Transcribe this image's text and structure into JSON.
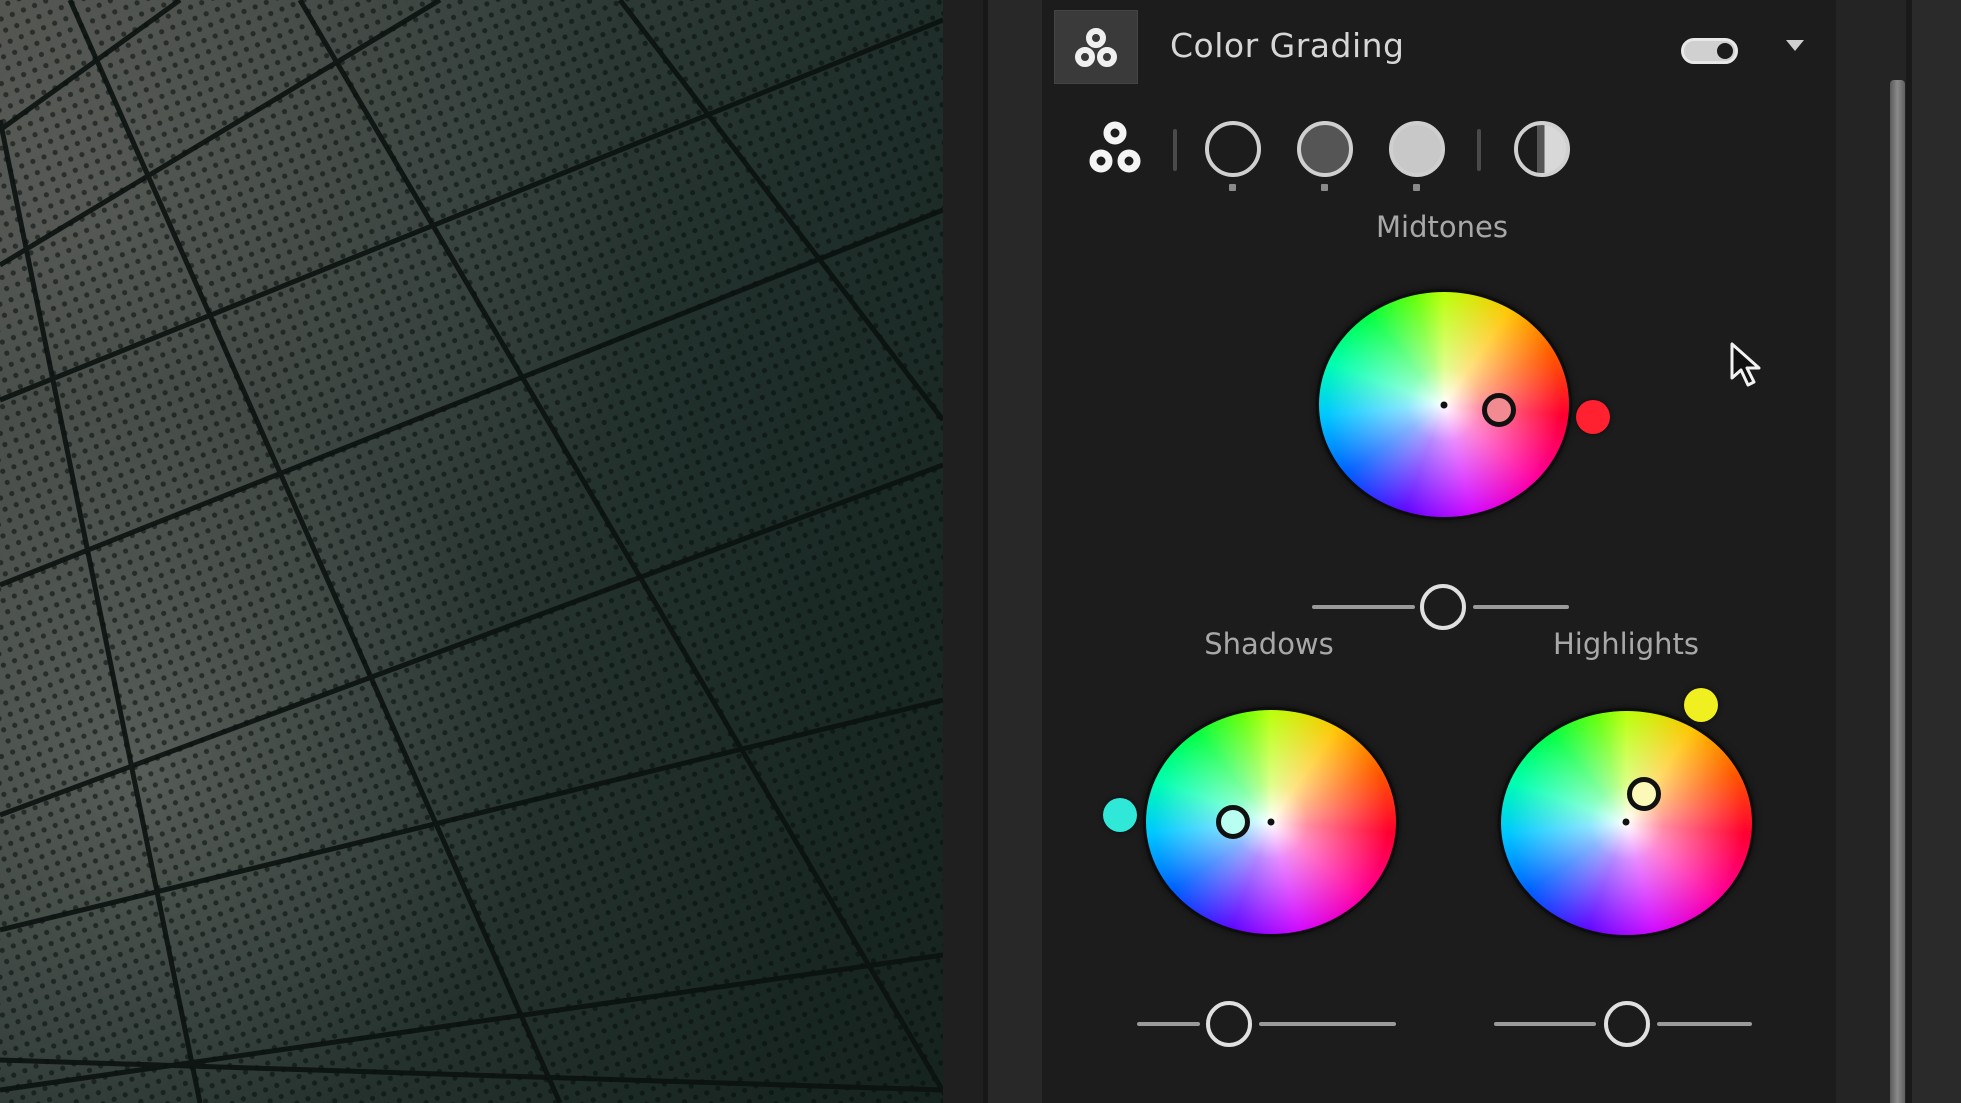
{
  "photo": {
    "subject": "perforated teal facade panels",
    "tint_color": "#1f2e2a"
  },
  "panel": {
    "title": "Color Grading",
    "header_icon": "three-circles-icon",
    "enabled": true,
    "collapse_icon": "caret-down-icon"
  },
  "modes": {
    "items": [
      {
        "name": "3-way",
        "icon": "three-circles-icon",
        "active": true
      },
      {
        "name": "Shadows",
        "icon": "circle-outline-icon",
        "active": false
      },
      {
        "name": "Midtones",
        "icon": "circle-gray-icon",
        "active": false
      },
      {
        "name": "Highlights",
        "icon": "circle-light-icon",
        "active": false
      },
      {
        "name": "Global",
        "icon": "half-circle-icon",
        "active": false
      }
    ]
  },
  "wheels": {
    "midtones": {
      "label": "Midtones",
      "tint_color": "#ff2030",
      "marker_color": "#f28a92"
    },
    "shadows": {
      "label": "Shadows",
      "tint_color": "#30e8d8",
      "marker_color": "#b8fff2"
    },
    "highlights": {
      "label": "Highlights",
      "tint_color": "#f0f020",
      "marker_color": "#fbf8b8"
    }
  },
  "sliders": {
    "midtones_luminance": 0.5,
    "shadows_luminance": 0.35,
    "highlights_luminance": 0.51
  }
}
